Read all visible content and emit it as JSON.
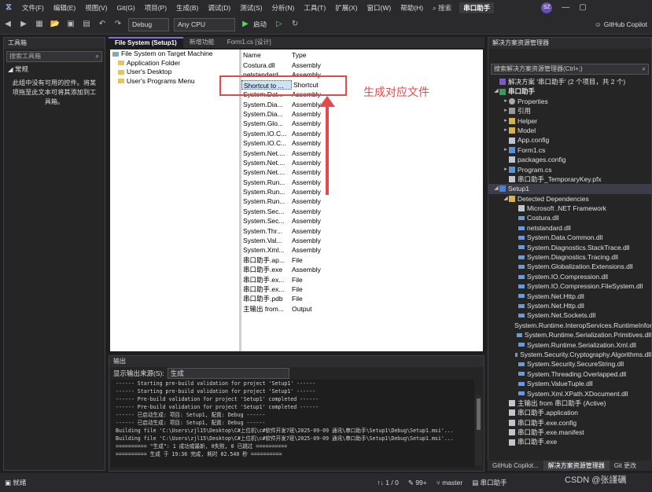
{
  "menubar": {
    "items": [
      "文件(F)",
      "编辑(E)",
      "视图(V)",
      "Git(G)",
      "项目(P)",
      "生成(B)",
      "调试(D)",
      "测试(S)",
      "分析(N)",
      "工具(T)",
      "扩展(X)",
      "窗口(W)",
      "帮助(H)"
    ],
    "search": "搜索",
    "solution_title": "串口助手",
    "avatar": "SZ"
  },
  "toolbar": {
    "config": "Debug",
    "platform": "Any CPU",
    "start_label": "启动",
    "copilot": "GitHub Copilot"
  },
  "toolbox": {
    "title": "工具箱",
    "search_placeholder": "搜索工具箱",
    "group": "常规",
    "message": "此组中没有可用的控件。将某项拖至此文本可将其添加到工具箱。"
  },
  "doc_tabs": [
    "File System (Setup1)",
    "新增功能",
    "Form1.cs [设计]"
  ],
  "filesystem": {
    "tree": [
      "File System on Target Machine",
      "Application Folder",
      "User's Desktop",
      "User's Programs Menu"
    ],
    "headers": {
      "name": "Name",
      "type": "Type"
    },
    "rows": [
      {
        "name": "Costura.dll",
        "type": "Assembly"
      },
      {
        "name": "netstandard...",
        "type": "Assembly"
      },
      {
        "name": "Shortcut to ...",
        "type": "Shortcut"
      },
      {
        "name": "System.Dat...",
        "type": "Assembly"
      },
      {
        "name": "System.Dia...",
        "type": "Assembly"
      },
      {
        "name": "System.Dia...",
        "type": "Assembly"
      },
      {
        "name": "System.Glo...",
        "type": "Assembly"
      },
      {
        "name": "System.IO.C...",
        "type": "Assembly"
      },
      {
        "name": "System.IO.C...",
        "type": "Assembly"
      },
      {
        "name": "System.Net....",
        "type": "Assembly"
      },
      {
        "name": "System.Net....",
        "type": "Assembly"
      },
      {
        "name": "System.Net....",
        "type": "Assembly"
      },
      {
        "name": "System.Run...",
        "type": "Assembly"
      },
      {
        "name": "System.Run...",
        "type": "Assembly"
      },
      {
        "name": "System.Run...",
        "type": "Assembly"
      },
      {
        "name": "System.Sec...",
        "type": "Assembly"
      },
      {
        "name": "System.Sec...",
        "type": "Assembly"
      },
      {
        "name": "System.Thr...",
        "type": "Assembly"
      },
      {
        "name": "System.Val...",
        "type": "Assembly"
      },
      {
        "name": "System.Xml...",
        "type": "Assembly"
      },
      {
        "name": "串口助手.ap...",
        "type": "File"
      },
      {
        "name": "串口助手.exe",
        "type": "Assembly"
      },
      {
        "name": "串口助手.ex...",
        "type": "File"
      },
      {
        "name": "串口助手.ex...",
        "type": "File"
      },
      {
        "name": "串口助手.pdb",
        "type": "File"
      },
      {
        "name": "主输出 from...",
        "type": "Output"
      }
    ]
  },
  "annotation": "生成对应文件",
  "output": {
    "title": "输出",
    "source_label": "显示输出来源(S):",
    "source_value": "生成",
    "lines": [
      "------ Starting pre-build validation for project 'Setup1' ------",
      "------ Starting pre-build validation for project 'Setup1' ------",
      "------ Pre-build validation for project 'Setup1' completed ------",
      "------ Pre-build validation for project 'Setup1' completed ------",
      "------ 已启动生成: 项目: Setup1, 配置: Debug ------",
      "------ 已启动生成: 项目: Setup1, 配置: Debug ------",
      "Building file 'C:\\Users\\zjl15\\Desktop\\C#上位机\\c#软件开发7班\\2025-09-09 通讯\\串口助手\\Setup1\\Debug\\Setup1.msi'...",
      "Building file 'C:\\Users\\zjl15\\Desktop\\C#上位机\\c#软件开发7班\\2025-09-09 通讯\\串口助手\\Setup1\\Debug\\Setup1.msi'...",
      "========== \"生成\": 1 成功或最新, 0失败, 0 已跳过 ==========",
      "========== 生成 于 19:36 完成, 耗时 02.540 秒 =========="
    ]
  },
  "solution_explorer": {
    "title": "解决方案资源管理器",
    "search_placeholder": "搜索解决方案资源管理器(Ctrl+;)",
    "nodes": [
      {
        "text": "解决方案 '串口助手' (2 个项目，共 2 个)",
        "depth": 0,
        "tri": "",
        "ico": "sln"
      },
      {
        "text": "串口助手",
        "depth": 0,
        "tri": "◢",
        "ico": "proj",
        "bold": true
      },
      {
        "text": "Properties",
        "depth": 1,
        "tri": "▸",
        "ico": "gear"
      },
      {
        "text": "引用",
        "depth": 1,
        "tri": "▸",
        "ico": "ref"
      },
      {
        "text": "Helper",
        "depth": 1,
        "tri": "▸",
        "ico": "folder-i"
      },
      {
        "text": "Model",
        "depth": 1,
        "tri": "▸",
        "ico": "folder-i"
      },
      {
        "text": "App.config",
        "depth": 1,
        "tri": "",
        "ico": "file"
      },
      {
        "text": "Form1.cs",
        "depth": 1,
        "tri": "▸",
        "ico": "cs"
      },
      {
        "text": "packages.config",
        "depth": 1,
        "tri": "",
        "ico": "file"
      },
      {
        "text": "Program.cs",
        "depth": 1,
        "tri": "▸",
        "ico": "cs"
      },
      {
        "text": "串口助手_TemporaryKey.pfx",
        "depth": 1,
        "tri": "",
        "ico": "file"
      },
      {
        "text": "Setup1",
        "depth": 0,
        "tri": "◢",
        "ico": "setup",
        "selected": true
      },
      {
        "text": "Detected Dependencies",
        "depth": 1,
        "tri": "◢",
        "ico": "folder-i"
      },
      {
        "text": "Microsoft .NET Framework",
        "depth": 2,
        "tri": "",
        "ico": "file"
      },
      {
        "text": "Costura.dll",
        "depth": 2,
        "tri": "",
        "ico": "dll"
      },
      {
        "text": "netstandard.dll",
        "depth": 2,
        "tri": "",
        "ico": "dll"
      },
      {
        "text": "System.Data.Common.dll",
        "depth": 2,
        "tri": "",
        "ico": "dll"
      },
      {
        "text": "System.Diagnostics.StackTrace.dll",
        "depth": 2,
        "tri": "",
        "ico": "dll"
      },
      {
        "text": "System.Diagnostics.Tracing.dll",
        "depth": 2,
        "tri": "",
        "ico": "dll"
      },
      {
        "text": "System.Globalization.Extensions.dll",
        "depth": 2,
        "tri": "",
        "ico": "dll"
      },
      {
        "text": "System.IO.Compression.dll",
        "depth": 2,
        "tri": "",
        "ico": "dll"
      },
      {
        "text": "System.IO.Compression.FileSystem.dll",
        "depth": 2,
        "tri": "",
        "ico": "dll"
      },
      {
        "text": "System.Net.Http.dll",
        "depth": 2,
        "tri": "",
        "ico": "dll"
      },
      {
        "text": "System.Net.Http.dll",
        "depth": 2,
        "tri": "",
        "ico": "dll"
      },
      {
        "text": "System.Net.Sockets.dll",
        "depth": 2,
        "tri": "",
        "ico": "dll"
      },
      {
        "text": "System.Runtime.InteropServices.RuntimeInformation.dll",
        "depth": 2,
        "tri": "",
        "ico": "dll"
      },
      {
        "text": "System.Runtime.Serialization.Primitives.dll",
        "depth": 2,
        "tri": "",
        "ico": "dll"
      },
      {
        "text": "System.Runtime.Serialization.Xml.dll",
        "depth": 2,
        "tri": "",
        "ico": "dll"
      },
      {
        "text": "System.Security.Cryptography.Algorithms.dll",
        "depth": 2,
        "tri": "",
        "ico": "dll"
      },
      {
        "text": "System.Security.SecureString.dll",
        "depth": 2,
        "tri": "",
        "ico": "dll"
      },
      {
        "text": "System.Threading.Overlapped.dll",
        "depth": 2,
        "tri": "",
        "ico": "dll"
      },
      {
        "text": "System.ValueTuple.dll",
        "depth": 2,
        "tri": "",
        "ico": "dll"
      },
      {
        "text": "System.Xml.XPath.XDocument.dll",
        "depth": 2,
        "tri": "",
        "ico": "dll"
      },
      {
        "text": "主输出 from 串口助手 (Active)",
        "depth": 1,
        "tri": "",
        "ico": "file"
      },
      {
        "text": "串口助手.application",
        "depth": 1,
        "tri": "",
        "ico": "file"
      },
      {
        "text": "串口助手.exe.config",
        "depth": 1,
        "tri": "",
        "ico": "file"
      },
      {
        "text": "串口助手.exe.manifest",
        "depth": 1,
        "tri": "",
        "ico": "file"
      },
      {
        "text": "串口助手.exe",
        "depth": 1,
        "tri": "",
        "ico": "file"
      }
    ],
    "bottom_tabs": [
      "GitHub Copilot...",
      "解决方案资源管理器",
      "Git 更改"
    ]
  },
  "statusbar": {
    "ready": "就绪",
    "line_col": "1 / 0",
    "errors": "99+",
    "branch": "master",
    "repo": "串口助手"
  },
  "watermark": "CSDN @张謹礪"
}
